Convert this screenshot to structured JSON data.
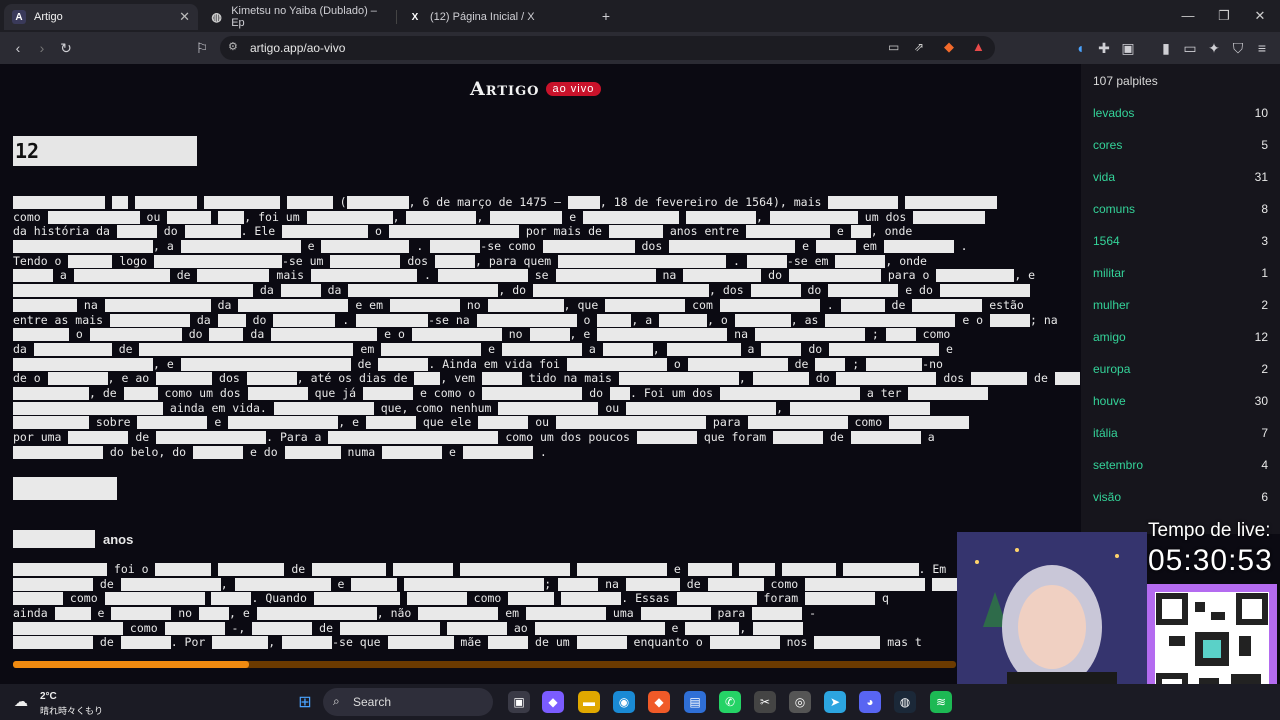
{
  "browser": {
    "tabs": [
      {
        "label": "Artigo",
        "icon": "A"
      },
      {
        "label": "Kimetsu no Yaiba (Dublado) – Ep",
        "icon": "globe"
      },
      {
        "label": "(12) Página Inicial / X",
        "icon": "X"
      }
    ],
    "url": "artigo.app/ao-vivo"
  },
  "page": {
    "brand_title": "Artigo",
    "brand_live": "ao vivo",
    "title_guess": "12",
    "subheading": "anos",
    "progress": 0.25
  },
  "article_lines": [
    [
      [
        92
      ],
      [
        " "
      ],
      [
        16
      ],
      [
        " "
      ],
      [
        62
      ],
      [
        " "
      ],
      [
        76
      ],
      [
        " "
      ],
      [
        46
      ],
      [
        " ("
      ],
      [
        62
      ],
      [
        ", 6 de março de 1475 — "
      ],
      [
        32
      ],
      [
        ", 18 de fevereiro de 1564), mais "
      ],
      [
        70
      ],
      [
        " "
      ],
      [
        92
      ]
    ],
    [
      [
        "como "
      ],
      [
        92
      ],
      [
        " ou "
      ],
      [
        44
      ],
      [
        " "
      ],
      [
        26
      ],
      [
        ", foi um "
      ],
      [
        86
      ],
      [
        ", "
      ],
      [
        70
      ],
      [
        ", "
      ],
      [
        72
      ],
      [
        " e "
      ],
      [
        96
      ],
      [
        " "
      ],
      [
        70
      ],
      [
        ", "
      ],
      [
        88
      ],
      [
        " um dos "
      ],
      [
        72
      ]
    ],
    [
      [
        "da história da "
      ],
      [
        40
      ],
      [
        " do "
      ],
      [
        56
      ],
      [
        ". Ele "
      ],
      [
        86
      ],
      [
        " o "
      ],
      [
        130
      ],
      [
        " por mais de "
      ],
      [
        54
      ],
      [
        " anos entre "
      ],
      [
        84
      ],
      [
        " e "
      ],
      [
        20
      ],
      [
        ", onde"
      ]
    ],
    [
      [
        140
      ],
      [
        ", a "
      ],
      [
        120
      ],
      [
        " e "
      ],
      [
        88
      ],
      [
        " . "
      ],
      [
        50
      ],
      [
        "-se como "
      ],
      [
        92
      ],
      [
        " dos "
      ],
      [
        126
      ],
      [
        " e "
      ],
      [
        40
      ],
      [
        " em "
      ],
      [
        70
      ],
      [
        " ."
      ]
    ],
    [
      [
        "Tendo o "
      ],
      [
        44
      ],
      [
        " logo "
      ],
      [
        128
      ],
      [
        "-se um "
      ],
      [
        70
      ],
      [
        " dos "
      ],
      [
        40
      ],
      [
        ", para quem "
      ],
      [
        168
      ],
      [
        " . "
      ],
      [
        40
      ],
      [
        "-se em "
      ],
      [
        50
      ],
      [
        ", onde"
      ]
    ],
    [
      [
        40
      ],
      [
        " a "
      ],
      [
        96
      ],
      [
        " de "
      ],
      [
        72
      ],
      [
        " mais "
      ],
      [
        106
      ],
      [
        " . "
      ],
      [
        90
      ],
      [
        " se "
      ],
      [
        100
      ],
      [
        " na "
      ],
      [
        78
      ],
      [
        " do "
      ],
      [
        92
      ],
      [
        " para o "
      ],
      [
        78
      ],
      [
        ", e"
      ]
    ],
    [
      [
        240
      ],
      [
        " da "
      ],
      [
        40
      ],
      [
        " da "
      ],
      [
        150
      ],
      [
        ", do "
      ],
      [
        176
      ],
      [
        ", dos "
      ],
      [
        50
      ],
      [
        " do "
      ],
      [
        70
      ],
      [
        " e do "
      ],
      [
        90
      ]
    ],
    [
      [
        64
      ],
      [
        " na "
      ],
      [
        106
      ],
      [
        " da "
      ],
      [
        110
      ],
      [
        " e em "
      ],
      [
        70
      ],
      [
        " no "
      ],
      [
        76
      ],
      [
        ", que "
      ],
      [
        80
      ],
      [
        " com "
      ],
      [
        100
      ],
      [
        " . "
      ],
      [
        44
      ],
      [
        " de "
      ],
      [
        70
      ],
      [
        " estão"
      ]
    ],
    [
      [
        "entre as mais "
      ],
      [
        80
      ],
      [
        " da "
      ],
      [
        28
      ],
      [
        " do "
      ],
      [
        62
      ],
      [
        " . "
      ],
      [
        72
      ],
      [
        "-se na "
      ],
      [
        100
      ],
      [
        " o "
      ],
      [
        34
      ],
      [
        ", a "
      ],
      [
        48
      ],
      [
        ", o "
      ],
      [
        56
      ],
      [
        ", as "
      ],
      [
        130
      ],
      [
        " e o "
      ],
      [
        40
      ],
      [
        "; na"
      ]
    ],
    [
      [
        56
      ],
      [
        " o "
      ],
      [
        92
      ],
      [
        " do "
      ],
      [
        34
      ],
      [
        " da "
      ],
      [
        106
      ],
      [
        " e o "
      ],
      [
        90
      ],
      [
        " no "
      ],
      [
        40
      ],
      [
        ", e "
      ],
      [
        130
      ],
      [
        " na "
      ],
      [
        110
      ],
      [
        " ; "
      ],
      [
        30
      ],
      [
        " como"
      ]
    ],
    [
      [
        "da "
      ],
      [
        78
      ],
      [
        " de "
      ],
      [
        214
      ],
      [
        " em "
      ],
      [
        100
      ],
      [
        " e "
      ],
      [
        80
      ],
      [
        " a "
      ],
      [
        50
      ],
      [
        ", "
      ],
      [
        74
      ],
      [
        " a "
      ],
      [
        40
      ],
      [
        " do "
      ],
      [
        110
      ],
      [
        " e"
      ]
    ],
    [
      [
        140
      ],
      [
        ", e "
      ],
      [
        170
      ],
      [
        " de "
      ],
      [
        50
      ],
      [
        ". Ainda em vida foi "
      ],
      [
        100
      ],
      [
        " o "
      ],
      [
        100
      ],
      [
        " de "
      ],
      [
        30
      ],
      [
        " ; "
      ],
      [
        56
      ],
      [
        "-no"
      ]
    ],
    [
      [
        "de o "
      ],
      [
        60
      ],
      [
        ", e ao "
      ],
      [
        56
      ],
      [
        " dos "
      ],
      [
        50
      ],
      [
        ", até os dias de "
      ],
      [
        26
      ],
      [
        ", vem "
      ],
      [
        40
      ],
      [
        " tido na mais "
      ],
      [
        120
      ],
      [
        ", "
      ],
      [
        56
      ],
      [
        " do "
      ],
      [
        100
      ],
      [
        " dos "
      ],
      [
        56
      ],
      [
        " de "
      ],
      [
        40
      ]
    ],
    [
      [
        76
      ],
      [
        ", de "
      ],
      [
        34
      ],
      [
        " como um dos "
      ],
      [
        60
      ],
      [
        " que já "
      ],
      [
        50
      ],
      [
        " e como o "
      ],
      [
        100
      ],
      [
        " do "
      ],
      [
        20
      ],
      [
        ". Foi um dos "
      ],
      [
        140
      ],
      [
        " a ter "
      ],
      [
        80
      ]
    ],
    [
      [
        150
      ],
      [
        " ainda em vida. "
      ],
      [
        100
      ],
      [
        " que, como nenhum "
      ],
      [
        100
      ],
      [
        " ou "
      ],
      [
        150
      ],
      [
        ", "
      ],
      [
        140
      ]
    ],
    [
      [
        76
      ],
      [
        " sobre "
      ],
      [
        70
      ],
      [
        " e "
      ],
      [
        110
      ],
      [
        ", e "
      ],
      [
        50
      ],
      [
        " que ele "
      ],
      [
        50
      ],
      [
        " ou "
      ],
      [
        150
      ],
      [
        " para "
      ],
      [
        100
      ],
      [
        " como "
      ],
      [
        80
      ]
    ],
    [
      [
        "por uma "
      ],
      [
        60
      ],
      [
        " de "
      ],
      [
        110
      ],
      [
        ". Para a "
      ],
      [
        170
      ],
      [
        " como um dos poucos "
      ],
      [
        60
      ],
      [
        " que foram "
      ],
      [
        50
      ],
      [
        " de "
      ],
      [
        70
      ],
      [
        " a"
      ]
    ],
    [
      [
        90
      ],
      [
        " do belo, do "
      ],
      [
        50
      ],
      [
        " e do "
      ],
      [
        56
      ],
      [
        " numa "
      ],
      [
        60
      ],
      [
        " e "
      ],
      [
        70
      ],
      [
        " ."
      ]
    ]
  ],
  "article2_lines": [
    [
      [
        94
      ],
      [
        " foi o "
      ],
      [
        56
      ],
      [
        " "
      ],
      [
        66
      ],
      [
        " de "
      ],
      [
        74
      ],
      [
        " "
      ],
      [
        60
      ],
      [
        " "
      ],
      [
        110
      ],
      [
        " "
      ],
      [
        90
      ],
      [
        " e "
      ],
      [
        44
      ],
      [
        " "
      ],
      [
        36
      ],
      [
        " "
      ],
      [
        54
      ],
      [
        " "
      ],
      [
        76
      ],
      [
        ". Em"
      ]
    ],
    [
      [
        80
      ],
      [
        " de "
      ],
      [
        100
      ],
      [
        ", "
      ],
      [
        96
      ],
      [
        " e "
      ],
      [
        46
      ],
      [
        " "
      ],
      [
        140
      ],
      [
        "; "
      ],
      [
        40
      ],
      [
        " na "
      ],
      [
        54
      ],
      [
        " de "
      ],
      [
        56
      ],
      [
        " como "
      ],
      [
        120
      ],
      [
        " "
      ],
      [
        88
      ]
    ],
    [
      [
        50
      ],
      [
        " como "
      ],
      [
        100
      ],
      [
        " "
      ],
      [
        40
      ],
      [
        ". Quando "
      ],
      [
        86
      ],
      [
        " "
      ],
      [
        60
      ],
      [
        " como "
      ],
      [
        46
      ],
      [
        " "
      ],
      [
        60
      ],
      [
        ". Essas "
      ],
      [
        80
      ],
      [
        " foram "
      ],
      [
        70
      ],
      [
        " q"
      ]
    ],
    [
      [
        "ainda "
      ],
      [
        36
      ],
      [
        " e "
      ],
      [
        60
      ],
      [
        " no "
      ],
      [
        30
      ],
      [
        ", e "
      ],
      [
        120
      ],
      [
        ", não "
      ],
      [
        80
      ],
      [
        " em "
      ],
      [
        80
      ],
      [
        " uma "
      ],
      [
        70
      ],
      [
        " para "
      ],
      [
        50
      ],
      [
        " -"
      ]
    ],
    [
      [
        110
      ],
      [
        " como "
      ],
      [
        60
      ],
      [
        " -, "
      ],
      [
        60
      ],
      [
        " de "
      ],
      [
        100
      ],
      [
        " "
      ],
      [
        60
      ],
      [
        " ao "
      ],
      [
        130
      ],
      [
        " e "
      ],
      [
        54
      ],
      [
        ", "
      ],
      [
        50
      ]
    ],
    [
      [
        80
      ],
      [
        " de "
      ],
      [
        50
      ],
      [
        ". Por "
      ],
      [
        56
      ],
      [
        ", "
      ],
      [
        50
      ],
      [
        "-se que "
      ],
      [
        66
      ],
      [
        " mãe "
      ],
      [
        40
      ],
      [
        " de um "
      ],
      [
        50
      ],
      [
        " enquanto o "
      ],
      [
        70
      ],
      [
        " nos "
      ],
      [
        66
      ],
      [
        " mas t"
      ]
    ]
  ],
  "sidebar": {
    "count_label": "107 palpites",
    "guesses": [
      {
        "word": "levados",
        "count": "10"
      },
      {
        "word": "cores",
        "count": "5"
      },
      {
        "word": "vida",
        "count": "31"
      },
      {
        "word": "comuns",
        "count": "8"
      },
      {
        "word": "1564",
        "count": "3"
      },
      {
        "word": "militar",
        "count": "1"
      },
      {
        "word": "mulher",
        "count": "2"
      },
      {
        "word": "amigo",
        "count": "12"
      },
      {
        "word": "europa",
        "count": "2"
      },
      {
        "word": "houve",
        "count": "30"
      },
      {
        "word": "itália",
        "count": "7"
      },
      {
        "word": "setembro",
        "count": "4"
      },
      {
        "word": "visão",
        "count": "6"
      }
    ]
  },
  "stream": {
    "live_label": "Tempo de live:",
    "live_time": "05:30:53"
  },
  "taskbar": {
    "temp": "2°C",
    "weather_desc": "晴れ時々くもり",
    "search_label": "Search"
  },
  "colors": {
    "accent_live": "#c9122a",
    "guess_green": "#34d399",
    "progress": "#f08a10"
  }
}
